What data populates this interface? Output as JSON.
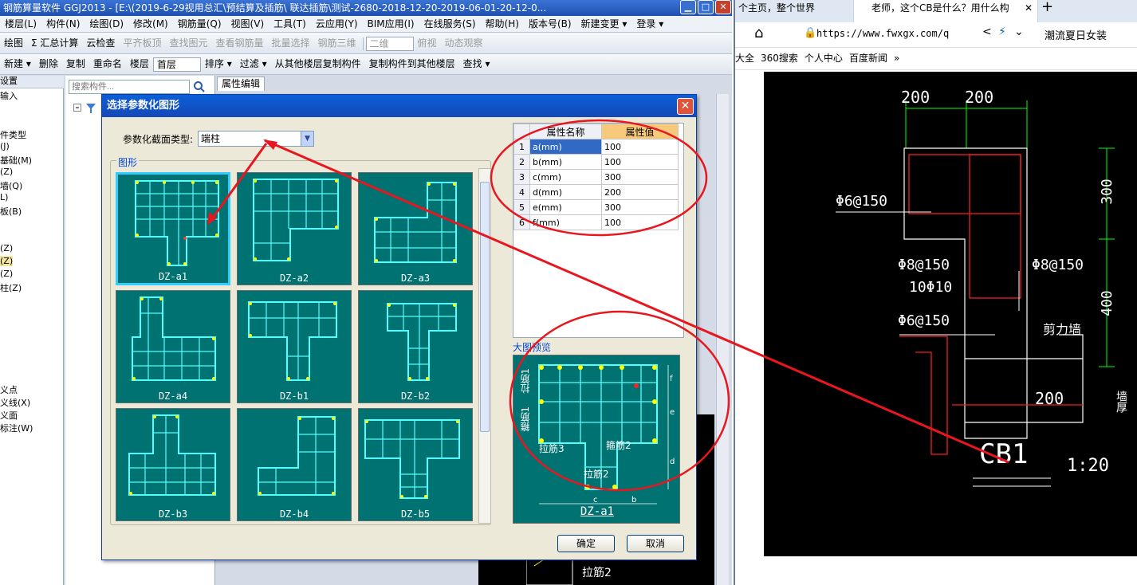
{
  "app": {
    "title": "钢筋算量软件 GGJ2013 - [E:\\(2019-6-29视用总汇\\预结算及插筋\\ 联达插筋\\测试-2680-2018-12-20-2019-06-01-20-12-0...",
    "menu": [
      "楼层(L)",
      "构件(N)",
      "绘图(D)",
      "修改(M)",
      "钢筋量(Q)",
      "视图(V)",
      "工具(T)",
      "云应用(Y)",
      "BIM应用(I)",
      "在线服务(S)",
      "帮助(H)",
      "版本号(B)",
      "新建变更 ▾",
      "登录 ▾"
    ],
    "toolbar1": [
      "绘图",
      "Σ 汇总计算",
      "云检查",
      "平齐板顶",
      "查找图元",
      "查看钢筋量",
      "批量选择",
      "钢筋三维",
      "二维",
      "俯视",
      "动态观察"
    ],
    "toolbar2": [
      "新建 ▾",
      "删除",
      "复制",
      "重命名",
      "楼层",
      "首层",
      "排序 ▾",
      "过滤 ▾",
      "从其他楼层复制构件",
      "复制构件到其他楼层",
      "查找 ▾"
    ],
    "left_items": [
      "设置",
      "输入",
      "件类型",
      "(J)",
      "基础(M)",
      "(Z)",
      "墙(Q)",
      "L)",
      "板(B)",
      "(Z)",
      "(Z)",
      "(Z)",
      "柱(Z)",
      "义点",
      "义线(X)",
      "义面",
      "标注(W)"
    ],
    "search_placeholder": "搜索构件...",
    "prop_tab": "属性编辑",
    "canvas_label": "拉筋2"
  },
  "dialog": {
    "title": "选择参数化图形",
    "type_label": "参数化截面类型:",
    "type_value": "端柱",
    "graph_legend": "图形",
    "thumbs": [
      "DZ-a1",
      "DZ-a2",
      "DZ-a3",
      "DZ-a4",
      "DZ-b1",
      "DZ-b2",
      "DZ-b3",
      "DZ-b4",
      "DZ-b5"
    ],
    "table_headers": [
      "属性名称",
      "属性值"
    ],
    "rows": [
      {
        "n": "1",
        "name": "a(mm)",
        "value": "100"
      },
      {
        "n": "2",
        "name": "b(mm)",
        "value": "100"
      },
      {
        "n": "3",
        "name": "c(mm)",
        "value": "300"
      },
      {
        "n": "4",
        "name": "d(mm)",
        "value": "200"
      },
      {
        "n": "5",
        "name": "e(mm)",
        "value": "300"
      },
      {
        "n": "6",
        "name": "f(mm)",
        "value": "100"
      }
    ],
    "preview_legend": "大图预览",
    "preview_caption": "DZ-a1",
    "preview_labels": [
      "拉筋1",
      "箍筋1",
      "拉筋3",
      "箍筋2",
      "拉筋2"
    ],
    "ok": "确定",
    "cancel": "取消"
  },
  "browser": {
    "tab1": "个主页，整个世界",
    "tab2": "老师，这个CB是什么？用什么构",
    "url": "https://www.fwxgx.com/q",
    "search_text": "潮流夏日女装",
    "bookmarks": [
      "大全",
      "360搜索",
      "个人中心",
      "百度新闻"
    ]
  },
  "cad": {
    "dims": [
      "200",
      "200",
      "300",
      "400",
      "200"
    ],
    "labels": [
      "Φ6@150",
      "Φ8@150",
      "10Φ10",
      "Φ8@150",
      "Φ6@150",
      "剪力墙",
      "墙厚"
    ],
    "title": "CB1",
    "scale": "1:20"
  },
  "colors": {
    "thumb_bg": "#007272",
    "annotation": "#e8161e",
    "cad_bg": "#000000"
  }
}
